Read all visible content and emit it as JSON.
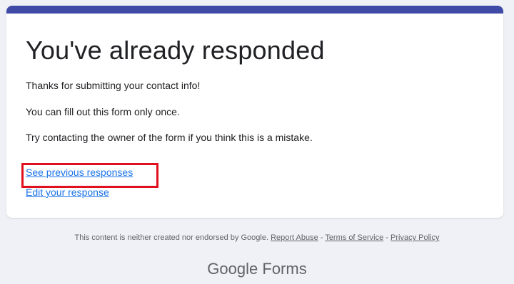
{
  "card": {
    "title": "You've already responded",
    "messages": [
      "Thanks for submitting your contact info!",
      "You can fill out this form only once.",
      "Try contacting the owner of the form if you think this is a mistake."
    ],
    "links": {
      "see_previous": "See previous responses",
      "edit_response": "Edit your response"
    }
  },
  "footer": {
    "disclaimer": "This content is neither created nor endorsed by Google.",
    "report_abuse": "Report Abuse",
    "sep1": " - ",
    "terms": "Terms of Service",
    "sep2": " - ",
    "privacy": "Privacy Policy"
  },
  "brand": {
    "google": "Google",
    "forms": "Forms"
  },
  "colors": {
    "accent_bar": "#3f4aa6",
    "link": "#1a73e8",
    "highlight": "#e0101e",
    "page_bg": "#f0f1f6"
  }
}
